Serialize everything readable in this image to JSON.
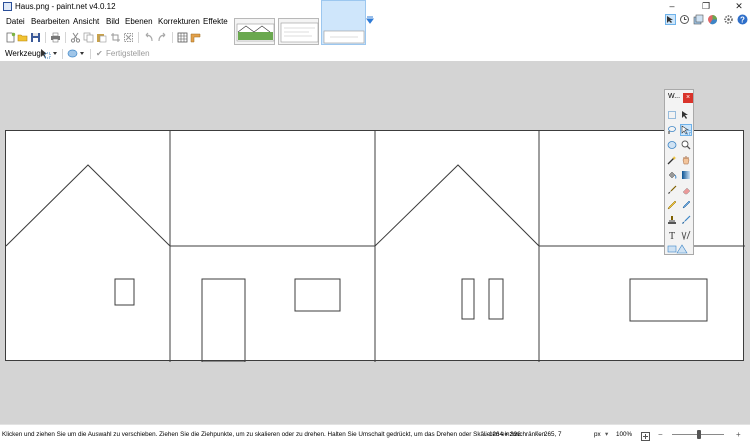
{
  "window": {
    "title": "Haus.png - paint.net v4.0.12"
  },
  "menu": {
    "items": [
      "Datei",
      "Bearbeiten",
      "Ansicht",
      "Bild",
      "Ebenen",
      "Korrekturen",
      "Effekte"
    ]
  },
  "toolbar": {
    "tools": [
      "new-file-icon",
      "open-file-icon",
      "save-icon",
      "print-icon",
      "cut-icon",
      "copy-icon",
      "paste-icon",
      "crop-icon",
      "deselect-icon",
      "undo-icon",
      "redo-icon",
      "grid-icon",
      "ruler-icon"
    ]
  },
  "tool_settings": {
    "label": "Werkzeug:",
    "finish_label": "Fertigstellen"
  },
  "tools_window": {
    "title": "W...",
    "close_label": "×",
    "tools": [
      "rectangle-select-icon",
      "move-selected-pixels-icon",
      "lasso-select-icon",
      "move-selection-icon",
      "ellipse-select-icon",
      "zoom-icon",
      "magic-wand-icon",
      "pan-icon",
      "paint-bucket-icon",
      "gradient-icon",
      "paintbrush-icon",
      "eraser-icon",
      "pencil-icon",
      "color-picker-icon",
      "clone-stamp-icon",
      "recolor-icon",
      "text-icon",
      "line-curve-icon",
      "shapes-icon"
    ],
    "selected_tool": "move-selection-icon"
  },
  "status": {
    "hint": "Klicken und ziehen Sie um die Auswahl zu verschieben. Ziehen Sie die Ziehpunkte, um zu skalieren oder zu drehen. Halten Sie Umschalt gedrückt, um das Drehen oder Skalieren einzuschränken.",
    "image_size": "1264 × 396",
    "cursor_pos": "265, 7",
    "unit": "px",
    "zoom": "100%"
  },
  "colors": {
    "canvas_background": "#d4d4d4",
    "selection_accent": "#cde6fb",
    "close_button": "#d9342b"
  }
}
